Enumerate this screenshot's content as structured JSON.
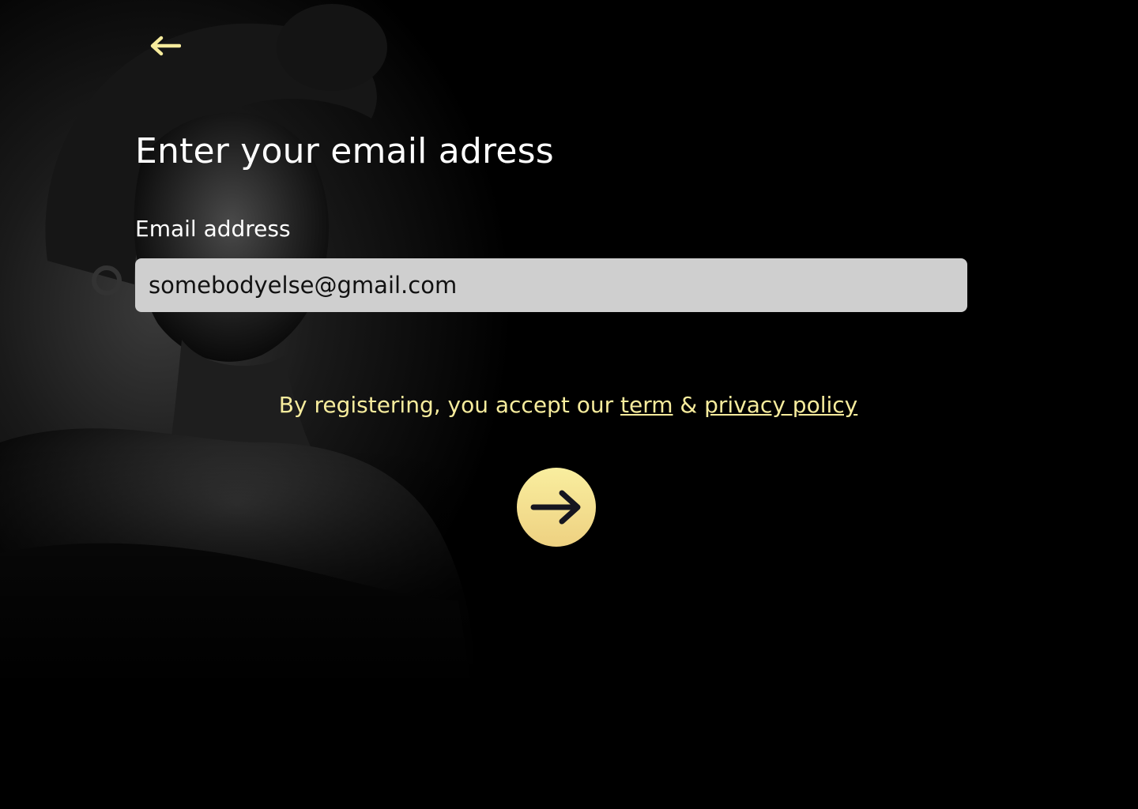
{
  "background": {
    "description_icon": "portrait-photo"
  },
  "nav": {
    "back_icon": "arrow-left-icon"
  },
  "title": "Enter your email adress",
  "email": {
    "label": "Email address",
    "value": "somebodyelse@gmail.com"
  },
  "terms": {
    "prefix": "By registering, you accept our ",
    "term_link": "term",
    "joiner": " & ",
    "privacy_link": " privacy policy"
  },
  "next": {
    "icon": "arrow-right-icon"
  },
  "colors": {
    "accent": "#f7ec9d",
    "accent_dark": "#eed181",
    "input_bg": "#cfcfcf",
    "background": "#000000",
    "text": "#ffffff"
  }
}
